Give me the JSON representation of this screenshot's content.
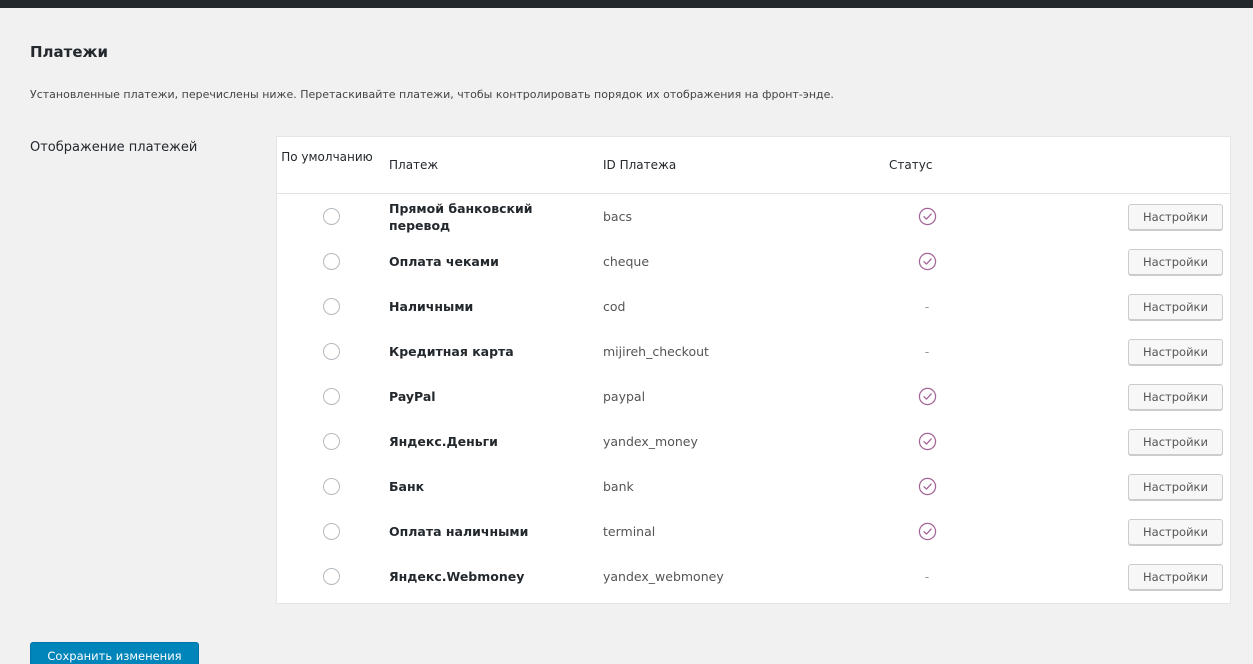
{
  "page": {
    "title": "Платежи",
    "description": "Установленные платежи, перечислены ниже. Перетаскивайте платежи, чтобы контролировать порядок их отображения на фронт-энде."
  },
  "section": {
    "label": "Отображение платежей"
  },
  "table": {
    "headers": {
      "default": "По умолчанию",
      "gateway": "Платеж",
      "id": "ID Платежа",
      "status": "Статус"
    },
    "rows": [
      {
        "name": "Прямой банковский перевод",
        "id": "bacs",
        "status": "enabled",
        "status_text": "",
        "button": "Настройки"
      },
      {
        "name": "Оплата чеками",
        "id": "cheque",
        "status": "enabled",
        "status_text": "",
        "button": "Настройки"
      },
      {
        "name": "Наличными",
        "id": "cod",
        "status": "disabled",
        "status_text": "-",
        "button": "Настройки"
      },
      {
        "name": "Кредитная карта",
        "id": "mijireh_checkout",
        "status": "disabled",
        "status_text": "-",
        "button": "Настройки"
      },
      {
        "name": "PayPal",
        "id": "paypal",
        "status": "enabled",
        "status_text": "",
        "button": "Настройки"
      },
      {
        "name": "Яндекс.Деньги",
        "id": "yandex_money",
        "status": "enabled",
        "status_text": "",
        "button": "Настройки"
      },
      {
        "name": "Банк",
        "id": "bank",
        "status": "enabled",
        "status_text": "",
        "button": "Настройки"
      },
      {
        "name": "Оплата наличными",
        "id": "terminal",
        "status": "enabled",
        "status_text": "",
        "button": "Настройки"
      },
      {
        "name": "Яндекс.Webmoney",
        "id": "yandex_webmoney",
        "status": "disabled",
        "status_text": "-",
        "button": "Настройки"
      }
    ]
  },
  "footer": {
    "save_label": "Сохранить изменения"
  },
  "icons": {
    "enabled_status": "check-circle-icon",
    "default_select": "radio-icon"
  },
  "colors": {
    "enabled_check": "#a46497",
    "primary_button": "#0085ba",
    "admin_bar": "#23282d"
  }
}
